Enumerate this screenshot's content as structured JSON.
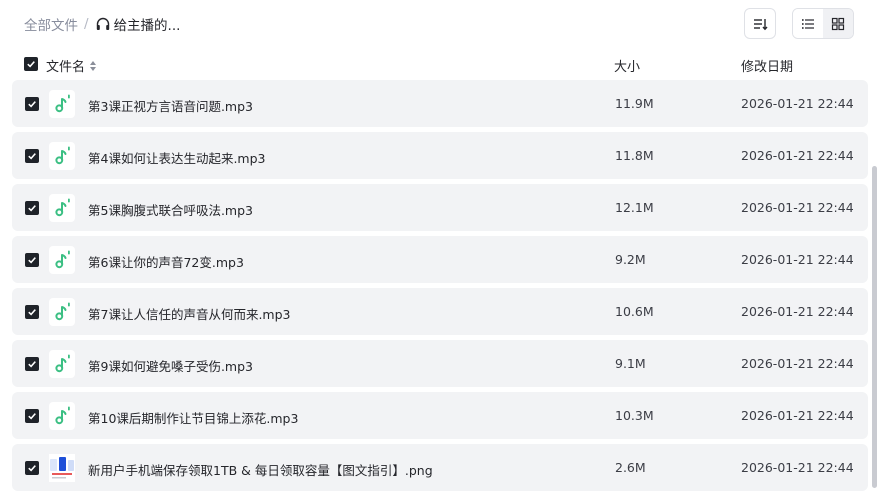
{
  "breadcrumb": {
    "root": "全部文件",
    "separator": "/",
    "current": "给主播的..."
  },
  "toolbar": {
    "sort_icon": "sort-lines-icon",
    "list_view_icon": "list-view-icon",
    "grid_view_icon": "grid-view-icon",
    "active_view": "list"
  },
  "columns": {
    "name": "文件名",
    "size": "大小",
    "date": "修改日期"
  },
  "colors": {
    "audio_icon": "#3bbf83",
    "checkbox": "#1f2329",
    "row_bg": "#f2f3f5"
  },
  "files": [
    {
      "name": "第3课正视方言语音问题.mp3",
      "size": "11.9M",
      "date": "2026-01-21 22:44",
      "type": "audio",
      "checked": true
    },
    {
      "name": "第4课如何让表达生动起来.mp3",
      "size": "11.8M",
      "date": "2026-01-21 22:44",
      "type": "audio",
      "checked": true
    },
    {
      "name": "第5课胸腹式联合呼吸法.mp3",
      "size": "12.1M",
      "date": "2026-01-21 22:44",
      "type": "audio",
      "checked": true
    },
    {
      "name": "第6课让你的声音72变.mp3",
      "size": "9.2M",
      "date": "2026-01-21 22:44",
      "type": "audio",
      "checked": true
    },
    {
      "name": "第7课让人信任的声音从何而来.mp3",
      "size": "10.6M",
      "date": "2026-01-21 22:44",
      "type": "audio",
      "checked": true
    },
    {
      "name": "第9课如何避免嗓子受伤.mp3",
      "size": "9.1M",
      "date": "2026-01-21 22:44",
      "type": "audio",
      "checked": true
    },
    {
      "name": "第10课后期制作让节目锦上添花.mp3",
      "size": "10.3M",
      "date": "2026-01-21 22:44",
      "type": "audio",
      "checked": true
    },
    {
      "name": "新用户手机端保存领取1TB & 每日领取容量【图文指引】.png",
      "size": "2.6M",
      "date": "2026-01-21 22:44",
      "type": "image",
      "checked": true
    }
  ]
}
